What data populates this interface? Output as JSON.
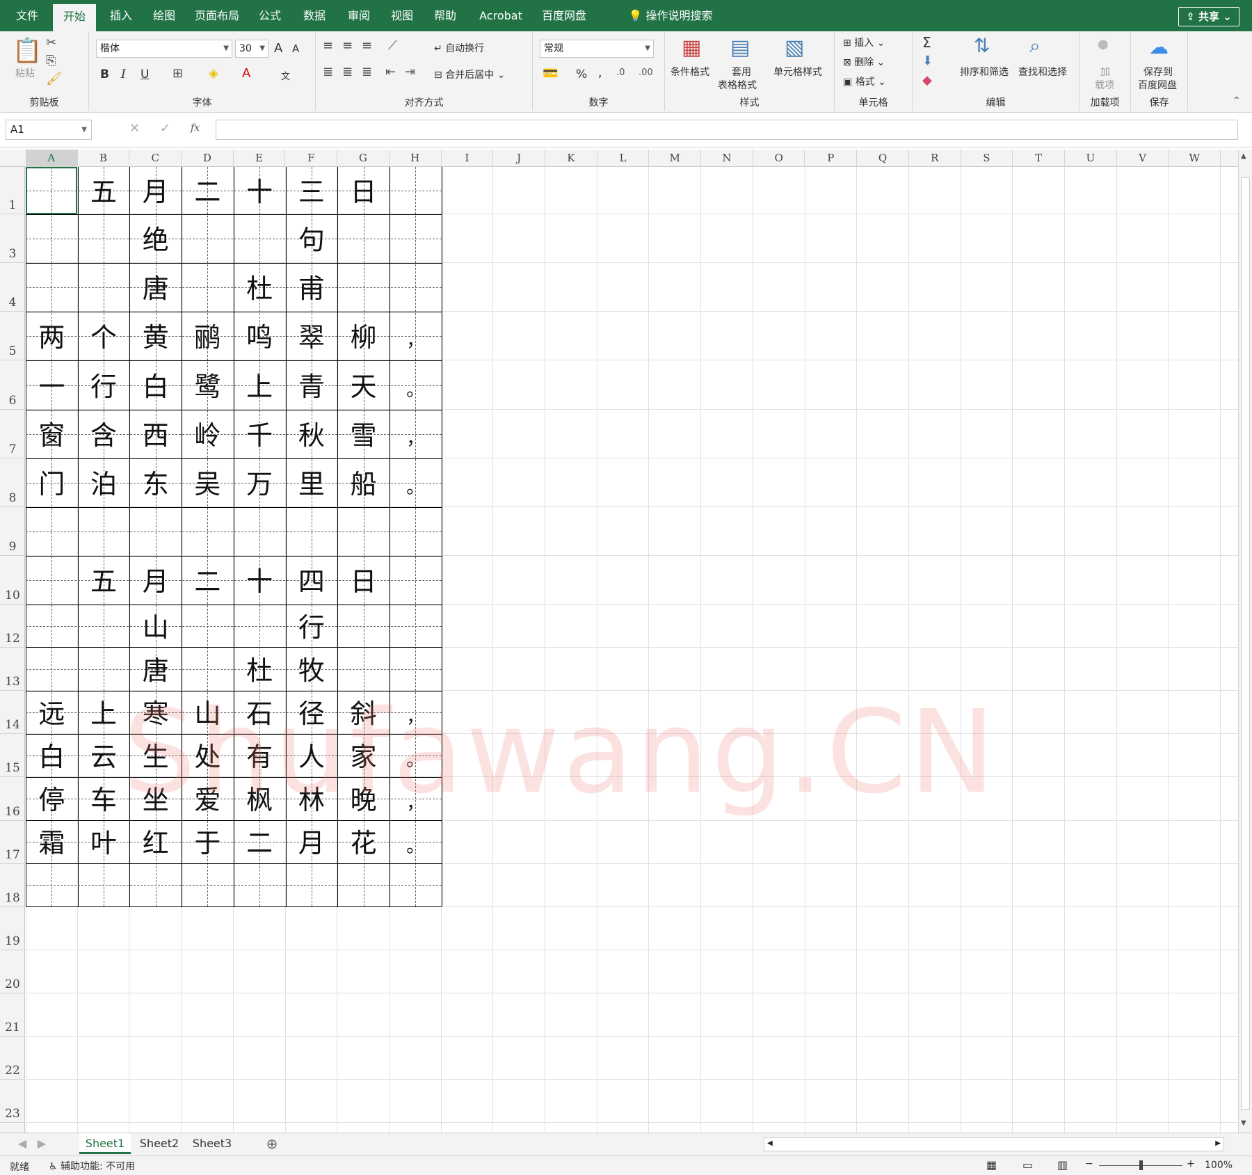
{
  "tabs": [
    "文件",
    "开始",
    "插入",
    "绘图",
    "页面布局",
    "公式",
    "数据",
    "审阅",
    "视图",
    "帮助",
    "Acrobat",
    "百度网盘"
  ],
  "active_tab": "开始",
  "tell_me": "操作说明搜索",
  "share_label": "共享",
  "ribbon": {
    "clipboard": {
      "paste": "粘贴",
      "label": "剪贴板"
    },
    "font": {
      "name": "楷体",
      "size": "30",
      "grow": "A",
      "shrink": "A",
      "bold": "B",
      "italic": "I",
      "underline": "U",
      "phonetic": "文",
      "label": "字体"
    },
    "alignment": {
      "wrap": "自动换行",
      "merge": "合并后居中",
      "label": "对齐方式"
    },
    "number": {
      "format": "常规",
      "percent": "%",
      "comma": ",",
      "label": "数字"
    },
    "styles": {
      "conditional": "条件格式",
      "table": "套用",
      "table2": "表格格式",
      "cell_styles": "单元格样式",
      "label": "样式"
    },
    "cells": {
      "insert": "插入",
      "delete": "删除",
      "format": "格式",
      "label": "单元格"
    },
    "editing": {
      "sum": "Σ",
      "sort": "排序和筛选",
      "find": "查找和选择",
      "label": "编辑"
    },
    "addins": {
      "name": "加",
      "name2": "载项",
      "label": "加载项"
    },
    "save": {
      "name": "保存到",
      "name2": "百度网盘",
      "label": "保存"
    }
  },
  "name_box": "A1",
  "fx": "fx",
  "columns": [
    "A",
    "B",
    "C",
    "D",
    "E",
    "F",
    "G",
    "H",
    "I",
    "J",
    "K",
    "L",
    "M",
    "N",
    "O",
    "P",
    "Q",
    "R",
    "S",
    "T",
    "U",
    "V",
    "W"
  ],
  "rows": [
    "1",
    "3",
    "4",
    "5",
    "6",
    "7",
    "8",
    "9",
    "10",
    "12",
    "13",
    "14",
    "15",
    "16",
    "17",
    "18",
    "19",
    "20",
    "21",
    "22",
    "23"
  ],
  "poem": [
    [
      "",
      "五",
      "月",
      "二",
      "十",
      "三",
      "日",
      ""
    ],
    [
      "",
      "",
      "绝",
      "",
      "",
      "句",
      "",
      ""
    ],
    [
      "",
      "",
      "唐",
      "",
      "杜",
      "甫",
      "",
      ""
    ],
    [
      "两",
      "个",
      "黄",
      "鹂",
      "鸣",
      "翠",
      "柳",
      "，"
    ],
    [
      "一",
      "行",
      "白",
      "鹭",
      "上",
      "青",
      "天",
      "。"
    ],
    [
      "窗",
      "含",
      "西",
      "岭",
      "千",
      "秋",
      "雪",
      "，"
    ],
    [
      "门",
      "泊",
      "东",
      "吴",
      "万",
      "里",
      "船",
      "。"
    ],
    [
      "",
      "",
      "",
      "",
      "",
      "",
      "",
      ""
    ],
    [
      "",
      "五",
      "月",
      "二",
      "十",
      "四",
      "日",
      ""
    ],
    [
      "",
      "",
      "山",
      "",
      "",
      "行",
      "",
      ""
    ],
    [
      "",
      "",
      "唐",
      "",
      "杜",
      "牧",
      "",
      ""
    ],
    [
      "远",
      "上",
      "寒",
      "山",
      "石",
      "径",
      "斜",
      "，"
    ],
    [
      "白",
      "云",
      "生",
      "处",
      "有",
      "人",
      "家",
      "。"
    ],
    [
      "停",
      "车",
      "坐",
      "爱",
      "枫",
      "林",
      "晚",
      "，"
    ],
    [
      "霜",
      "叶",
      "红",
      "于",
      "二",
      "月",
      "花",
      "。"
    ],
    [
      "",
      "",
      "",
      "",
      "",
      "",
      "",
      ""
    ]
  ],
  "watermark": "Shufawang.CN",
  "sheets": [
    "Sheet1",
    "Sheet2",
    "Sheet3"
  ],
  "active_sheet": "Sheet1",
  "status": {
    "ready": "就绪",
    "accessibility": "辅助功能: 不可用",
    "zoom": "100%"
  }
}
